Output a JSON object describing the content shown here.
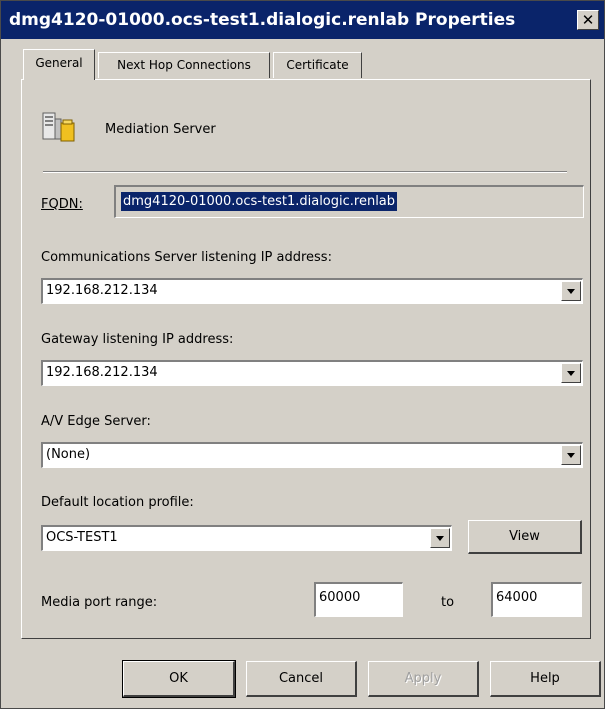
{
  "window": {
    "title": "dmg4120-01000.ocs-test1.dialogic.renlab Properties",
    "close_symbol": "✕"
  },
  "tabs": [
    {
      "label": "General",
      "active": true
    },
    {
      "label": "Next Hop Connections",
      "active": false
    },
    {
      "label": "Certificate",
      "active": false
    }
  ],
  "header": {
    "icon": "server-icon",
    "role": "Mediation Server"
  },
  "fqdn": {
    "label": "FQDN:",
    "value": "dmg4120-01000.ocs-test1.dialogic.renlab"
  },
  "comm_server_ip": {
    "label": "Communications Server listening IP address:",
    "value": "192.168.212.134"
  },
  "gateway_ip": {
    "label": "Gateway listening IP address:",
    "value": "192.168.212.134"
  },
  "av_edge": {
    "label": "A/V Edge Server:",
    "value": "(None)"
  },
  "location_profile": {
    "label": "Default location profile:",
    "value": "OCS-TEST1",
    "view_button": "View"
  },
  "media_port": {
    "label": "Media port range:",
    "from": "60000",
    "to_label": "to",
    "to": "64000"
  },
  "buttons": {
    "ok": "OK",
    "cancel": "Cancel",
    "apply": "Apply",
    "help": "Help"
  },
  "colors": {
    "title_bar": "#0a246a",
    "face": "#d4d0c8",
    "selection": "#0a246a"
  }
}
